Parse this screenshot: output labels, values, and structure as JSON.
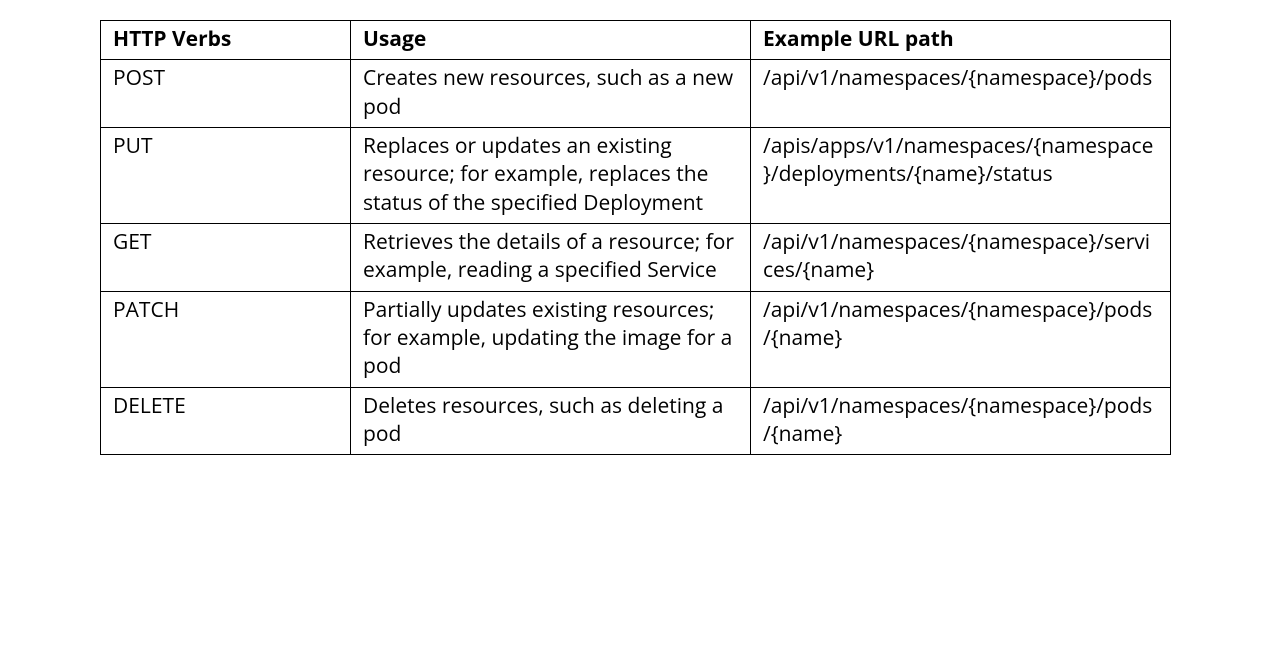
{
  "chart_data": {
    "type": "table",
    "columns": [
      "HTTP Verbs",
      "Usage",
      "Example URL path"
    ],
    "rows": [
      {
        "verb": "POST",
        "usage": "Creates new resources, such as a new pod",
        "url": "/api/v1/namespaces/{namespace}/pods"
      },
      {
        "verb": "PUT",
        "usage": "Replaces or updates an existing resource; for example, replaces the status of the specified Deployment",
        "url": "/apis/apps/v1/namespaces/{namespace}/deployments/{name}/status"
      },
      {
        "verb": "GET",
        "usage": "Retrieves the details of a resource; for example, reading a specified Service",
        "url": "/api/v1/namespaces/{namespace}/services/{name}"
      },
      {
        "verb": "PATCH",
        "usage": "Partially updates existing resources; for example, updating the image for a pod",
        "url": "/api/v1/namespaces/{namespace}/pods/{name}"
      },
      {
        "verb": "DELETE",
        "usage": "Deletes resources, such as deleting a pod",
        "url": "/api/v1/namespaces/{namespace}/pods/{name}"
      }
    ]
  }
}
